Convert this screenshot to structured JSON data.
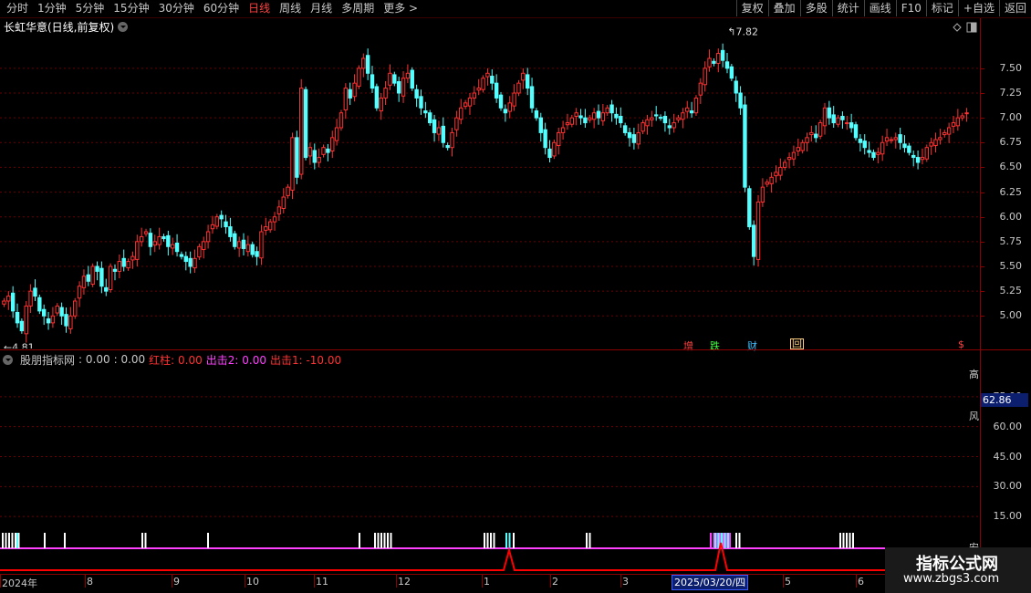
{
  "toolbar": {
    "periods": [
      "分时",
      "1分钟",
      "5分钟",
      "15分钟",
      "30分钟",
      "60分钟",
      "日线",
      "周线",
      "月线",
      "多周期",
      "更多 >"
    ],
    "active_period": "日线",
    "actions": [
      "复权",
      "叠加",
      "多股",
      "统计",
      "画线",
      "F10",
      "标记",
      "+自选",
      "返回"
    ]
  },
  "chart_title": "长虹华意(日线,前复权)",
  "indicator": {
    "name": "股朋指标网",
    "values": [
      ": 0.00",
      ": 0.00"
    ],
    "hongzhu": "红柱: 0.00",
    "chuji2": "出击2: 0.00",
    "chuji1": "出击1: -10.00"
  },
  "price_axis": [
    "7.50",
    "7.25",
    "7.00",
    "6.75",
    "6.50",
    "6.25",
    "6.00",
    "5.75",
    "5.50",
    "5.25",
    "5.00"
  ],
  "ind_axis": [
    "75.00",
    "60.00",
    "45.00",
    "30.00",
    "15.00"
  ],
  "ind_current": "62.86",
  "high_label": "7.82",
  "low_label": "4.81",
  "signals": {
    "zeng": "增",
    "die": "跌",
    "cai": "财",
    "hui": "回",
    "s": "$"
  },
  "right_marks": {
    "top": "高",
    "mid": "风",
    "bottom": "安"
  },
  "months": [
    "2024年",
    "8",
    "9",
    "10",
    "11",
    "12",
    "1",
    "2",
    "3",
    "4",
    "5",
    "6"
  ],
  "date_highlight": "2025/03/20/四",
  "watermark": {
    "title": "指标公式网",
    "url": "www.zbgs3.com"
  },
  "colors": {
    "up": "#ff3232",
    "down": "#54ffff",
    "grid": "#8b0000",
    "magenta": "#ff40ff",
    "red": "#ff0000"
  },
  "chart_data": {
    "type": "candlestick",
    "y_range": [
      4.8,
      7.95
    ],
    "closes": [
      5.15,
      5.2,
      5.05,
      4.93,
      4.85,
      5.1,
      5.25,
      5.2,
      5.05,
      5.0,
      4.93,
      5.0,
      5.1,
      5.0,
      4.9,
      5.0,
      5.15,
      5.3,
      5.4,
      5.35,
      5.5,
      5.45,
      5.3,
      5.25,
      5.5,
      5.45,
      5.55,
      5.5,
      5.55,
      5.6,
      5.75,
      5.8,
      5.85,
      5.7,
      5.75,
      5.8,
      5.78,
      5.7,
      5.72,
      5.65,
      5.6,
      5.55,
      5.5,
      5.58,
      5.7,
      5.75,
      5.85,
      5.92,
      6.0,
      5.98,
      5.9,
      5.8,
      5.7,
      5.75,
      5.68,
      5.72,
      5.62,
      5.6,
      5.85,
      5.9,
      5.95,
      6.0,
      6.1,
      6.2,
      6.3,
      6.8,
      6.4,
      7.3,
      6.6,
      6.7,
      6.55,
      6.6,
      6.7,
      6.65,
      6.8,
      6.9,
      7.05,
      7.3,
      7.2,
      7.35,
      7.5,
      7.6,
      7.45,
      7.3,
      7.1,
      7.2,
      7.3,
      7.45,
      7.35,
      7.25,
      7.4,
      7.45,
      7.3,
      7.2,
      7.1,
      7.05,
      6.95,
      6.85,
      6.9,
      6.75,
      6.7,
      6.85,
      7.0,
      7.1,
      7.15,
      7.2,
      7.25,
      7.3,
      7.4,
      7.45,
      7.35,
      7.2,
      7.1,
      7.05,
      7.15,
      7.25,
      7.35,
      7.45,
      7.3,
      7.1,
      7.0,
      6.85,
      6.7,
      6.6,
      6.75,
      6.85,
      6.9,
      6.95,
      7.0,
      7.05,
      7.0,
      6.95,
      7.0,
      7.05,
      7.0,
      7.05,
      7.1,
      7.05,
      7.0,
      6.95,
      6.85,
      6.8,
      6.75,
      6.85,
      6.95,
      6.98,
      7.0,
      7.02,
      7.0,
      6.95,
      6.9,
      6.95,
      7.0,
      7.05,
      7.1,
      7.05,
      7.2,
      7.35,
      7.5,
      7.6,
      7.55,
      7.65,
      7.58,
      7.5,
      7.4,
      7.25,
      7.1,
      6.3,
      5.9,
      5.6,
      6.15,
      6.3,
      6.35,
      6.4,
      6.45,
      6.5,
      6.55,
      6.6,
      6.65,
      6.7,
      6.75,
      6.8,
      6.85,
      6.8,
      6.95,
      7.1,
      7.0,
      6.95,
      7.0,
      6.98,
      6.95,
      6.9,
      6.8,
      6.75,
      6.7,
      6.65,
      6.6,
      6.65,
      6.75,
      6.8,
      6.78,
      6.8,
      6.75,
      6.7,
      6.65,
      6.6,
      6.55,
      6.6,
      6.7,
      6.75,
      6.78,
      6.8,
      6.85,
      6.9,
      6.95,
      7.0,
      7.02,
      7.05
    ]
  }
}
